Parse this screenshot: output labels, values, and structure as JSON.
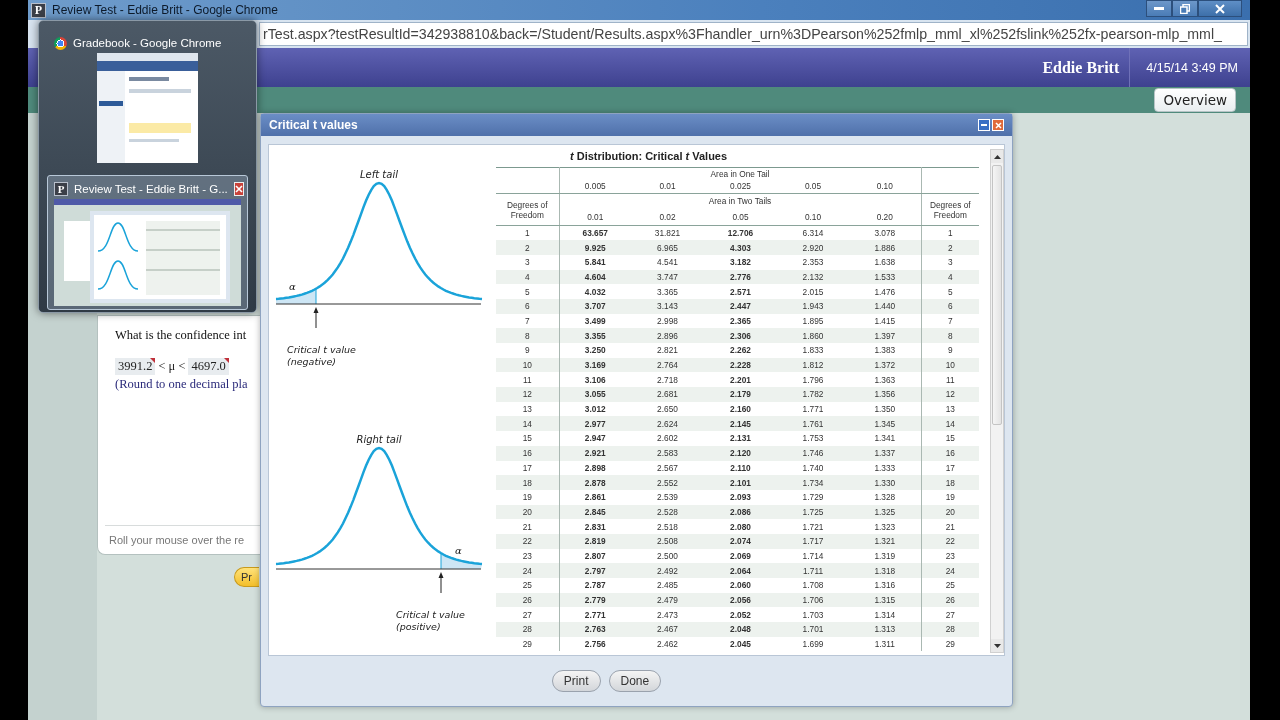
{
  "browser": {
    "favicon": "P",
    "title": "Review Test - Eddie Britt - Google Chrome",
    "address": "rTest.aspx?testResultId=342938810&back=/Student/Results.aspx%3Fhandler_urn%3DPearson%252fmlp_mml_xl%252fslink%252fx-pearson-mlp_mml_"
  },
  "switcher": {
    "items": [
      {
        "kind": "browser",
        "title": "Gradebook - Google Chrome",
        "selected": false
      },
      {
        "kind": "page",
        "favicon": "P",
        "title": "Review Test - Eddie Britt - G...",
        "selected": true
      }
    ]
  },
  "header": {
    "user": "Eddie Britt",
    "datetime": "4/15/14 3:49 PM"
  },
  "nav": {
    "button": "Overview"
  },
  "question": {
    "prompt": "What is the confidence int",
    "lower": "3991.2",
    "symbol": "< μ <",
    "upper": "4697.0",
    "hint": "(Round to one decimal pla",
    "footer": "Roll your mouse over the re",
    "button": "Pr"
  },
  "dialog": {
    "title": "Critical t values",
    "figures": [
      {
        "kind": "left",
        "title": "Left tail",
        "alpha": "α",
        "caption": "Critical t value",
        "note": "(negative)"
      },
      {
        "kind": "right",
        "title": "Right tail",
        "alpha": "α",
        "caption": "Critical t value",
        "note": "(positive)"
      }
    ],
    "table": {
      "title": "*t* Distribution: Critical *t* Values",
      "one_tail_label": "Area in One Tail",
      "one_tail": [
        "0.005",
        "0.01",
        "0.025",
        "0.05",
        "0.10"
      ],
      "two_tails_label": "Area in Two Tails",
      "two_tails": [
        "0.01",
        "0.02",
        "0.05",
        "0.10",
        "0.20"
      ],
      "df_left": "Degrees of Freedom",
      "df_right": "Degrees of Freedom",
      "rows": [
        [
          "1",
          "63.657",
          "31.821",
          "12.706",
          "6.314",
          "3.078",
          "1"
        ],
        [
          "2",
          "9.925",
          "6.965",
          "4.303",
          "2.920",
          "1.886",
          "2"
        ],
        [
          "3",
          "5.841",
          "4.541",
          "3.182",
          "2.353",
          "1.638",
          "3"
        ],
        [
          "4",
          "4.604",
          "3.747",
          "2.776",
          "2.132",
          "1.533",
          "4"
        ],
        [
          "5",
          "4.032",
          "3.365",
          "2.571",
          "2.015",
          "1.476",
          "5"
        ],
        [
          "6",
          "3.707",
          "3.143",
          "2.447",
          "1.943",
          "1.440",
          "6"
        ],
        [
          "7",
          "3.499",
          "2.998",
          "2.365",
          "1.895",
          "1.415",
          "7"
        ],
        [
          "8",
          "3.355",
          "2.896",
          "2.306",
          "1.860",
          "1.397",
          "8"
        ],
        [
          "9",
          "3.250",
          "2.821",
          "2.262",
          "1.833",
          "1.383",
          "9"
        ],
        [
          "10",
          "3.169",
          "2.764",
          "2.228",
          "1.812",
          "1.372",
          "10"
        ],
        [
          "11",
          "3.106",
          "2.718",
          "2.201",
          "1.796",
          "1.363",
          "11"
        ],
        [
          "12",
          "3.055",
          "2.681",
          "2.179",
          "1.782",
          "1.356",
          "12"
        ],
        [
          "13",
          "3.012",
          "2.650",
          "2.160",
          "1.771",
          "1.350",
          "13"
        ],
        [
          "14",
          "2.977",
          "2.624",
          "2.145",
          "1.761",
          "1.345",
          "14"
        ],
        [
          "15",
          "2.947",
          "2.602",
          "2.131",
          "1.753",
          "1.341",
          "15"
        ],
        [
          "16",
          "2.921",
          "2.583",
          "2.120",
          "1.746",
          "1.337",
          "16"
        ],
        [
          "17",
          "2.898",
          "2.567",
          "2.110",
          "1.740",
          "1.333",
          "17"
        ],
        [
          "18",
          "2.878",
          "2.552",
          "2.101",
          "1.734",
          "1.330",
          "18"
        ],
        [
          "19",
          "2.861",
          "2.539",
          "2.093",
          "1.729",
          "1.328",
          "19"
        ],
        [
          "20",
          "2.845",
          "2.528",
          "2.086",
          "1.725",
          "1.325",
          "20"
        ],
        [
          "21",
          "2.831",
          "2.518",
          "2.080",
          "1.721",
          "1.323",
          "21"
        ],
        [
          "22",
          "2.819",
          "2.508",
          "2.074",
          "1.717",
          "1.321",
          "22"
        ],
        [
          "23",
          "2.807",
          "2.500",
          "2.069",
          "1.714",
          "1.319",
          "23"
        ],
        [
          "24",
          "2.797",
          "2.492",
          "2.064",
          "1.711",
          "1.318",
          "24"
        ],
        [
          "25",
          "2.787",
          "2.485",
          "2.060",
          "1.708",
          "1.316",
          "25"
        ],
        [
          "26",
          "2.779",
          "2.479",
          "2.056",
          "1.706",
          "1.315",
          "26"
        ],
        [
          "27",
          "2.771",
          "2.473",
          "2.052",
          "1.703",
          "1.314",
          "27"
        ],
        [
          "28",
          "2.763",
          "2.467",
          "2.048",
          "1.701",
          "1.313",
          "28"
        ],
        [
          "29",
          "2.756",
          "2.462",
          "2.045",
          "1.699",
          "1.311",
          "29"
        ]
      ]
    },
    "buttons": [
      "Print",
      "Done"
    ]
  }
}
